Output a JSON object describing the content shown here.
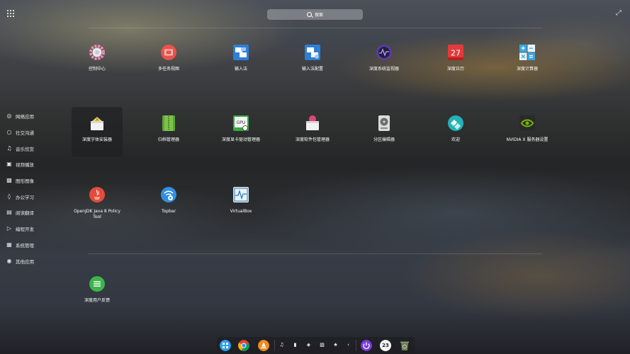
{
  "search": {
    "placeholder": "搜索"
  },
  "sidebar": {
    "categories": [
      {
        "label": "网络应用",
        "icon": "globe-icon"
      },
      {
        "label": "社交沟通",
        "icon": "chat-icon"
      },
      {
        "label": "音乐欣赏",
        "icon": "music-icon"
      },
      {
        "label": "视频播放",
        "icon": "video-icon"
      },
      {
        "label": "图形图像",
        "icon": "image-icon"
      },
      {
        "label": "办公学习",
        "icon": "office-icon"
      },
      {
        "label": "阅读翻译",
        "icon": "book-icon"
      },
      {
        "label": "编程开发",
        "icon": "code-icon"
      },
      {
        "label": "系统管理",
        "icon": "system-icon"
      },
      {
        "label": "其他应用",
        "icon": "more-icon"
      }
    ]
  },
  "apps": {
    "section1": [
      {
        "label": "控制中心",
        "icon": "control-center-icon"
      },
      {
        "label": "多任务视图",
        "icon": "multitask-view-icon"
      },
      {
        "label": "输入法",
        "icon": "input-method-icon"
      },
      {
        "label": "输入法配置",
        "icon": "input-method-config-icon"
      },
      {
        "label": "深度系统监视器",
        "icon": "system-monitor-icon"
      },
      {
        "label": "深度日历",
        "icon": "calendar-icon",
        "badge": "27"
      },
      {
        "label": "深度计算器",
        "icon": "calculator-icon"
      },
      {
        "label": "深度字体安装器",
        "icon": "font-installer-icon",
        "selected": true
      },
      {
        "label": "归档管理器",
        "icon": "archive-manager-icon"
      },
      {
        "label": "深度显卡驱动管理器",
        "icon": "gpu-driver-manager-icon",
        "badge": "GPU"
      },
      {
        "label": "深度软件包管理器",
        "icon": "package-manager-icon"
      },
      {
        "label": "分区编辑器",
        "icon": "partition-editor-icon"
      },
      {
        "label": "欢迎",
        "icon": "welcome-icon"
      },
      {
        "label": "NVIDIA X 服务器设置",
        "icon": "nvidia-settings-icon"
      },
      {
        "label": "OpenJDK Java 8 Policy Tool",
        "icon": "java-policy-tool-icon"
      },
      {
        "label": "Topbar",
        "icon": "topbar-icon"
      },
      {
        "label": "VirtualBox",
        "icon": "virtualbox-icon"
      }
    ],
    "section2": [
      {
        "label": "深度用户反馈",
        "icon": "user-feedback-icon"
      }
    ]
  },
  "dock": {
    "apps": [
      "launcher-icon",
      "chrome-icon",
      "vlc-icon"
    ],
    "tray": [
      "volume-icon",
      "battery-icon",
      "wifi-icon",
      "keyboard-icon",
      "input-tray-icon",
      "collapse-left-icon"
    ],
    "power_icon": "power-icon",
    "clock_text": "23",
    "trash_icon": "trash-icon"
  }
}
